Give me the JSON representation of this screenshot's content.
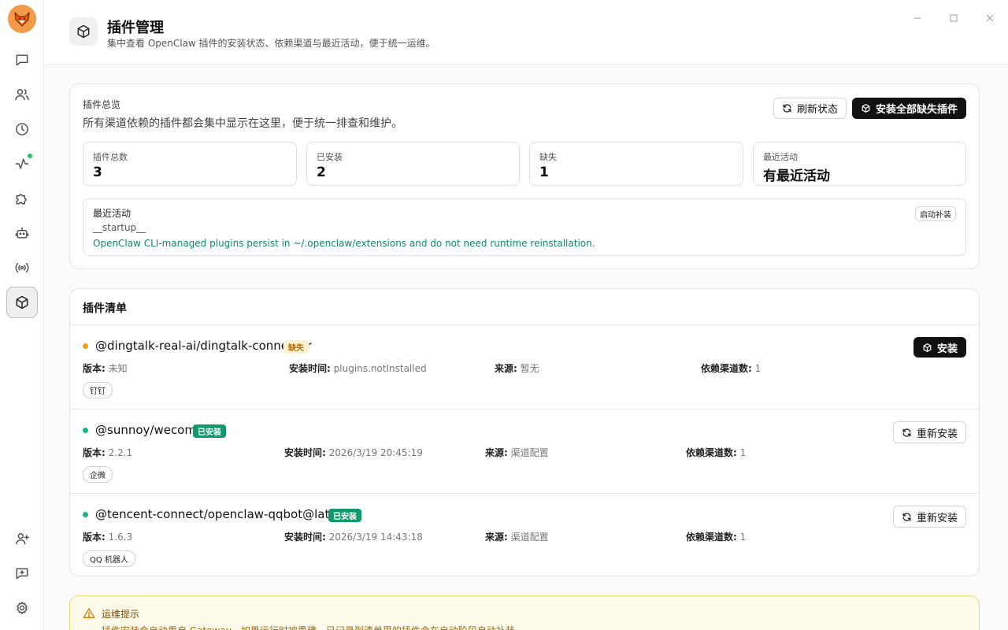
{
  "header": {
    "title": "插件管理",
    "subtitle": "集中查看 OpenClaw 插件的安装状态、依赖渠道与最近活动，便于统一运维。"
  },
  "overview": {
    "title": "插件总览",
    "description": "所有渠道依赖的插件都会集中显示在这里，便于统一排查和维护。",
    "refresh_label": "刷新状态",
    "install_all_label": "安装全部缺失插件",
    "stats": [
      {
        "label": "插件总数",
        "value": "3"
      },
      {
        "label": "已安装",
        "value": "2"
      },
      {
        "label": "缺失",
        "value": "1"
      },
      {
        "label": "最近活动",
        "value": "有最近活动"
      }
    ],
    "recent": {
      "title": "最近活动",
      "tag": "启动补装",
      "name": "__startup__",
      "message": "OpenClaw CLI-managed plugins persist in ~/.openclaw/extensions and do not need runtime reinstallation."
    }
  },
  "list": {
    "title": "插件清单",
    "labels": {
      "version": "版本:",
      "install_time": "安装时间:",
      "source": "来源:",
      "deps": "依赖渠道数:"
    },
    "plugins": [
      {
        "name": "@dingtalk-real-ai/dingtalk-connector",
        "status": "缺失",
        "status_color": "#f59e0b",
        "version": "未知",
        "install_time": "plugins.notInstalled",
        "source": "暂无",
        "deps": "1",
        "channel": "钉钉",
        "action": "安装"
      },
      {
        "name": "@sunnoy/wecom",
        "status": "已安装",
        "status_color": "#10b981",
        "version": "2.2.1",
        "install_time": "2026/3/19 20:45:19",
        "source": "渠道配置",
        "deps": "1",
        "channel": "企微",
        "action": "重新安装"
      },
      {
        "name": "@tencent-connect/openclaw-qqbot@latest",
        "status": "已安装",
        "status_color": "#10b981",
        "version": "1.6.3",
        "install_time": "2026/3/19 14:43:18",
        "source": "渠道配置",
        "deps": "1",
        "channel": "QQ 机器人",
        "action": "重新安装"
      }
    ]
  },
  "tip": {
    "title": "运维提示",
    "text": "插件安装会自动重启 Gateway。如果运行时被重建，已记录到清单里的插件会在启动阶段自动补装。"
  },
  "icons": {
    "logo": "fox-logo-icon",
    "nav": [
      "chat-icon",
      "users-icon",
      "clock-icon",
      "activity-icon",
      "puzzle-icon",
      "robot-icon",
      "broadcast-icon",
      "package-icon",
      "add-user-icon",
      "add-message-icon",
      "settings-icon"
    ]
  },
  "colors": {
    "accent_dark": "#111111",
    "success": "#0f9a6a",
    "warning": "#f59e0b",
    "activity_text": "#0f8a5f"
  }
}
